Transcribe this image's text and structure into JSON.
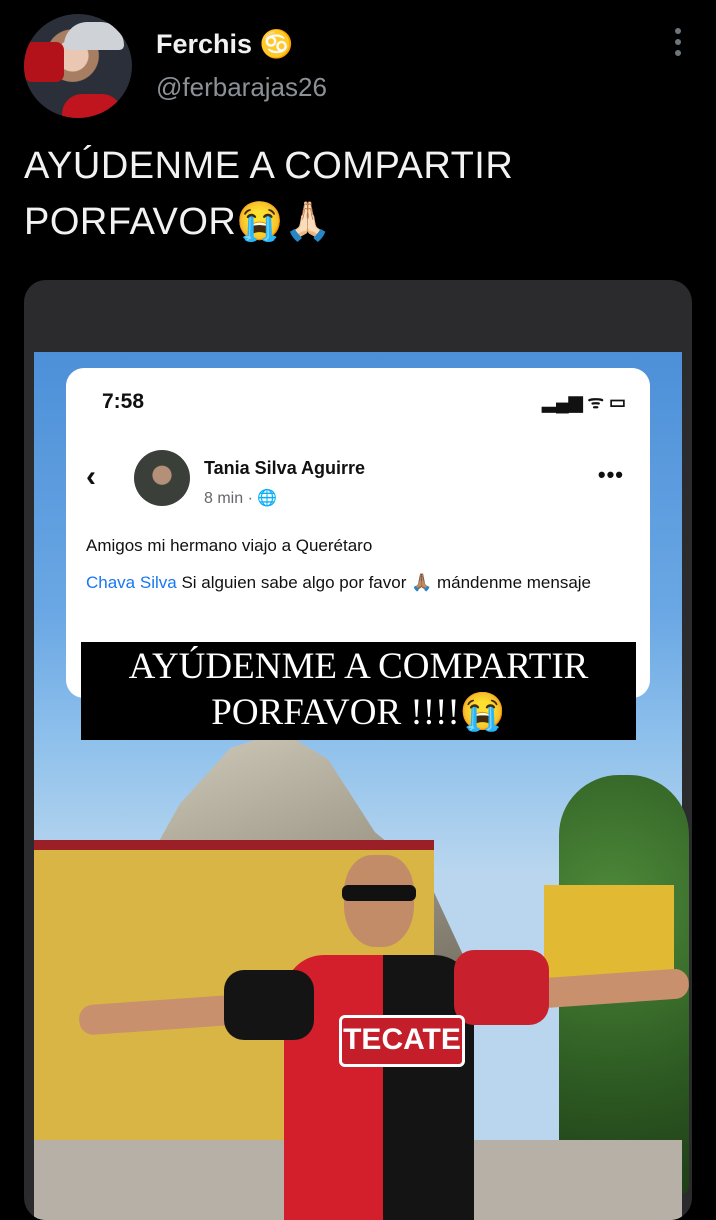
{
  "author": {
    "name": "Ferchis ♋",
    "handle": "@ferbarajas26"
  },
  "tweet": {
    "text": "AYÚDENME A COMPARTIR PORFAVOR😭🙏🏻"
  },
  "media": {
    "phone_screenshot": {
      "status_time": "7:58",
      "status_icons": "▂▄▆ ᯤ ▭",
      "back": "‹",
      "post_author": "Tania Silva Aguirre",
      "post_meta": "8 min · 🌐",
      "more": "•••",
      "line1": "Amigos mi hermano viajo a Querétaro",
      "mention": "Chava Silva",
      "line2_rest": " Si alguien sabe algo por favor 🙏🏽 mándenme mensaje"
    },
    "overlay_text_line1": "AYÚDENME A COMPARTIR",
    "overlay_text_line2": "PORFAVOR !!!!😭",
    "jersey_logo": "TECATE"
  }
}
